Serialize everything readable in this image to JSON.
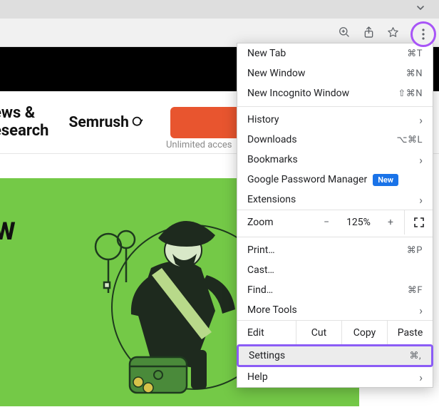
{
  "toolbar": {
    "zoom_icon": "zoom-icon",
    "share_icon": "share-icon",
    "star_icon": "star-icon",
    "menu_icon": "menu-icon",
    "chevron_down": "chevron-down-icon"
  },
  "page": {
    "nav_news": "ews &",
    "nav_research": "esearch",
    "brand": "Semrush",
    "cta": " ",
    "unlimited": "Unlimited acces",
    "hero": "W"
  },
  "menu": {
    "new_tab": "New Tab",
    "new_tab_sc": "⌘T",
    "new_window": "New Window",
    "new_window_sc": "⌘N",
    "incognito": "New Incognito Window",
    "incognito_sc": "⇧⌘N",
    "history": "History",
    "downloads": "Downloads",
    "downloads_sc": "⌥⌘L",
    "bookmarks": "Bookmarks",
    "gpm": "Google Password Manager",
    "gpm_badge": "New",
    "extensions": "Extensions",
    "zoom_label": "Zoom",
    "zoom_minus": "−",
    "zoom_val": "125%",
    "zoom_plus": "+",
    "print": "Print…",
    "print_sc": "⌘P",
    "cast": "Cast…",
    "find": "Find…",
    "find_sc": "⌘F",
    "more_tools": "More Tools",
    "edit_label": "Edit",
    "cut": "Cut",
    "copy": "Copy",
    "paste": "Paste",
    "settings": "Settings",
    "settings_sc": "⌘,",
    "help": "Help"
  }
}
